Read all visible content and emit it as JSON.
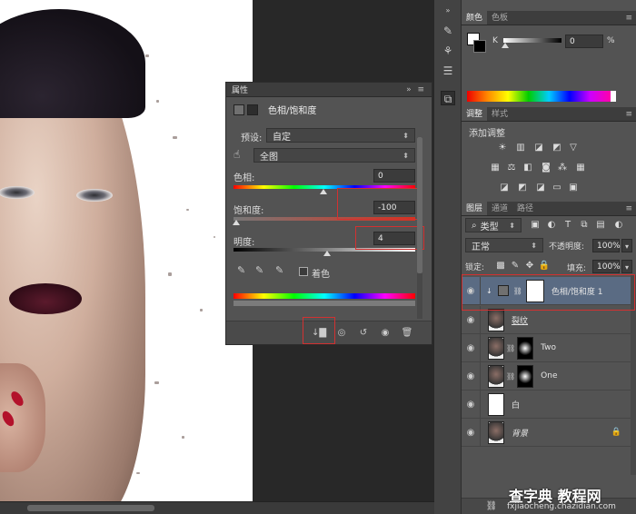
{
  "properties_panel": {
    "tab": "属性",
    "header_title": "色相/饱和度",
    "preset_label": "预设:",
    "preset_value": "自定",
    "channel_value": "全图",
    "hue_label": "色相:",
    "hue_value": "0",
    "saturation_label": "饱和度:",
    "saturation_value": "-100",
    "lightness_label": "明度:",
    "lightness_value": "4",
    "colorize_label": "着色",
    "icons": [
      "hand-scrub-icon",
      "eyedropper-icon",
      "eyedropper-plus-icon",
      "eyedropper-minus-icon",
      "clip-layer-icon",
      "visibility-toggle-icon",
      "reset-icon",
      "eye-icon",
      "trash-icon"
    ]
  },
  "color_panel": {
    "tabs": [
      "颜色",
      "色板"
    ],
    "channel_label": "K",
    "value": "0",
    "unit": "%"
  },
  "adjustments_panel": {
    "tabs": [
      "调整",
      "样式"
    ],
    "title": "添加调整"
  },
  "layers_panel": {
    "tabs": [
      "图层",
      "通道",
      "路径"
    ],
    "filter_label": "类型",
    "blend_mode": "正常",
    "opacity_label": "不透明度:",
    "opacity_value": "100%",
    "lock_label": "锁定:",
    "fill_label": "填充:",
    "fill_value": "100%",
    "layers": [
      {
        "name": "色相/饱和度 1",
        "selected": true
      },
      {
        "name": "裂纹"
      },
      {
        "name": "Two"
      },
      {
        "name": "One"
      },
      {
        "name": "白"
      },
      {
        "name": "背景",
        "locked": true
      }
    ]
  },
  "watermark": {
    "main": "查字典 教程网",
    "url": "fxjiaocheng.chazidian.com"
  },
  "colors": {
    "panel_bg": "#535353",
    "selected_layer": "#5a6b83",
    "highlight_box": "#d23131"
  }
}
